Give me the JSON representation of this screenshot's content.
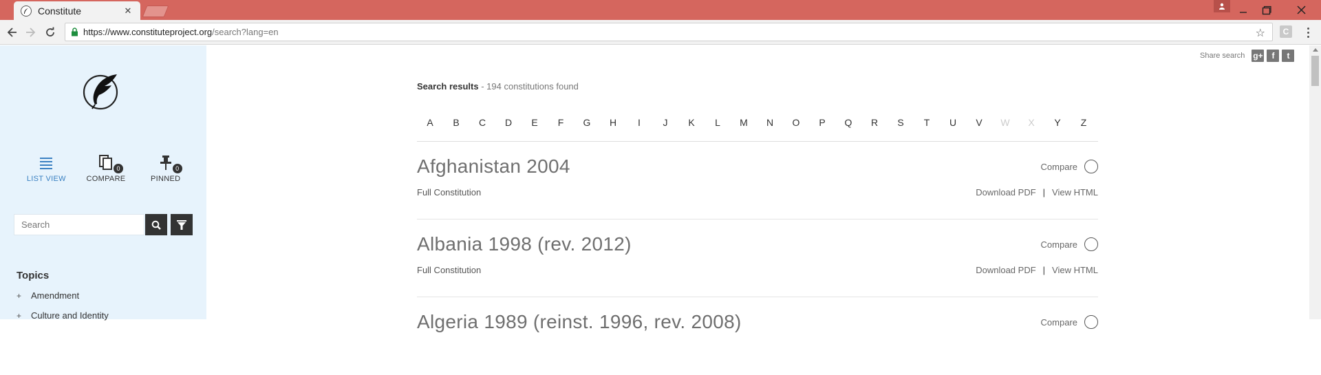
{
  "browser": {
    "tab_title": "Constitute",
    "tab_close": "✕",
    "url_host": "https://www.constituteproject.org",
    "url_path": "/search?lang=en",
    "extension_label": "C"
  },
  "sidebar": {
    "views": [
      {
        "label": "LIST VIEW",
        "icon": "list-icon",
        "active": true
      },
      {
        "label": "COMPARE",
        "icon": "compare-icon",
        "count": "0"
      },
      {
        "label": "PINNED",
        "icon": "pin-icon",
        "count": "0"
      }
    ],
    "search_placeholder": "Search",
    "topics_title": "Topics",
    "topics": [
      "Amendment",
      "Culture and Identity"
    ],
    "topic_marker": "+"
  },
  "main": {
    "share_label": "Share search",
    "share_icons": [
      "g+",
      "f",
      "t"
    ],
    "results_label": "Search results",
    "results_dash": " - ",
    "results_count": "194 constitutions found",
    "alphabet": [
      "A",
      "B",
      "C",
      "D",
      "E",
      "F",
      "G",
      "H",
      "I",
      "J",
      "K",
      "L",
      "M",
      "N",
      "O",
      "P",
      "Q",
      "R",
      "S",
      "T",
      "U",
      "V",
      "W",
      "X",
      "Y",
      "Z"
    ],
    "alphabet_disabled": [
      "W",
      "X"
    ],
    "results": [
      {
        "title": "Afghanistan 2004",
        "compare_label": "Compare",
        "type": "Full Constitution",
        "download": "Download PDF",
        "separator": "|",
        "view": "View HTML"
      },
      {
        "title": "Albania 1998 (rev. 2012)",
        "compare_label": "Compare",
        "type": "Full Constitution",
        "download": "Download PDF",
        "separator": "|",
        "view": "View HTML"
      },
      {
        "title": "Algeria 1989 (reinst. 1996, rev. 2008)",
        "compare_label": "Compare",
        "type": "",
        "download": "",
        "separator": "",
        "view": ""
      }
    ]
  },
  "colors": {
    "titlebar": "#d5665e",
    "sidebar_bg": "#e7f3fc",
    "accent": "#3a80c2",
    "dark_button": "#333333"
  }
}
